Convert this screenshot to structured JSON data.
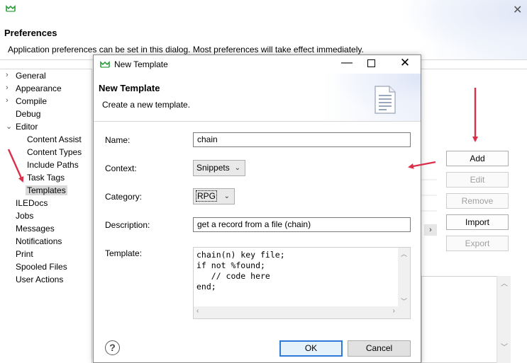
{
  "preferences": {
    "title": "Preferences",
    "description": "Application preferences can be set in this dialog. Most preferences will take effect immediately.",
    "tree": [
      {
        "label": "General",
        "expandable": true
      },
      {
        "label": "Appearance",
        "expandable": true
      },
      {
        "label": "Compile",
        "expandable": true
      },
      {
        "label": "Debug",
        "expandable": false
      },
      {
        "label": "Editor",
        "expanded": true
      },
      {
        "label": "Content Assist"
      },
      {
        "label": "Content Types"
      },
      {
        "label": "Include Paths"
      },
      {
        "label": "Task Tags"
      },
      {
        "label": "Templates",
        "selected": true
      },
      {
        "label": "ILEDocs",
        "expandable": false
      },
      {
        "label": "Jobs"
      },
      {
        "label": "Messages"
      },
      {
        "label": "Notifications"
      },
      {
        "label": "Print"
      },
      {
        "label": "Spooled Files"
      },
      {
        "label": "User Actions"
      }
    ],
    "buttons": {
      "add": "Add",
      "edit": "Edit",
      "remove": "Remove",
      "import": "Import",
      "export": "Export"
    }
  },
  "dialog": {
    "window_title": "New Template",
    "heading": "New Template",
    "subheading": "Create a new template.",
    "fields": {
      "name_label": "Name:",
      "name_value": "chain",
      "context_label": "Context:",
      "context_value": "Snippets",
      "category_label": "Category:",
      "category_value": "RPG",
      "description_label": "Description:",
      "description_value": "get a record from a file (chain)",
      "template_label": "Template:",
      "template_value": "chain(n) key file;\nif not %found;\n   // code here\nend;"
    },
    "buttons": {
      "help": "?",
      "ok": "OK",
      "cancel": "Cancel"
    }
  },
  "colors": {
    "annotation_arrow": "#d9304a",
    "default_button_border": "#2f7ad6",
    "selected_tree_bg": "#d9d9d9"
  }
}
